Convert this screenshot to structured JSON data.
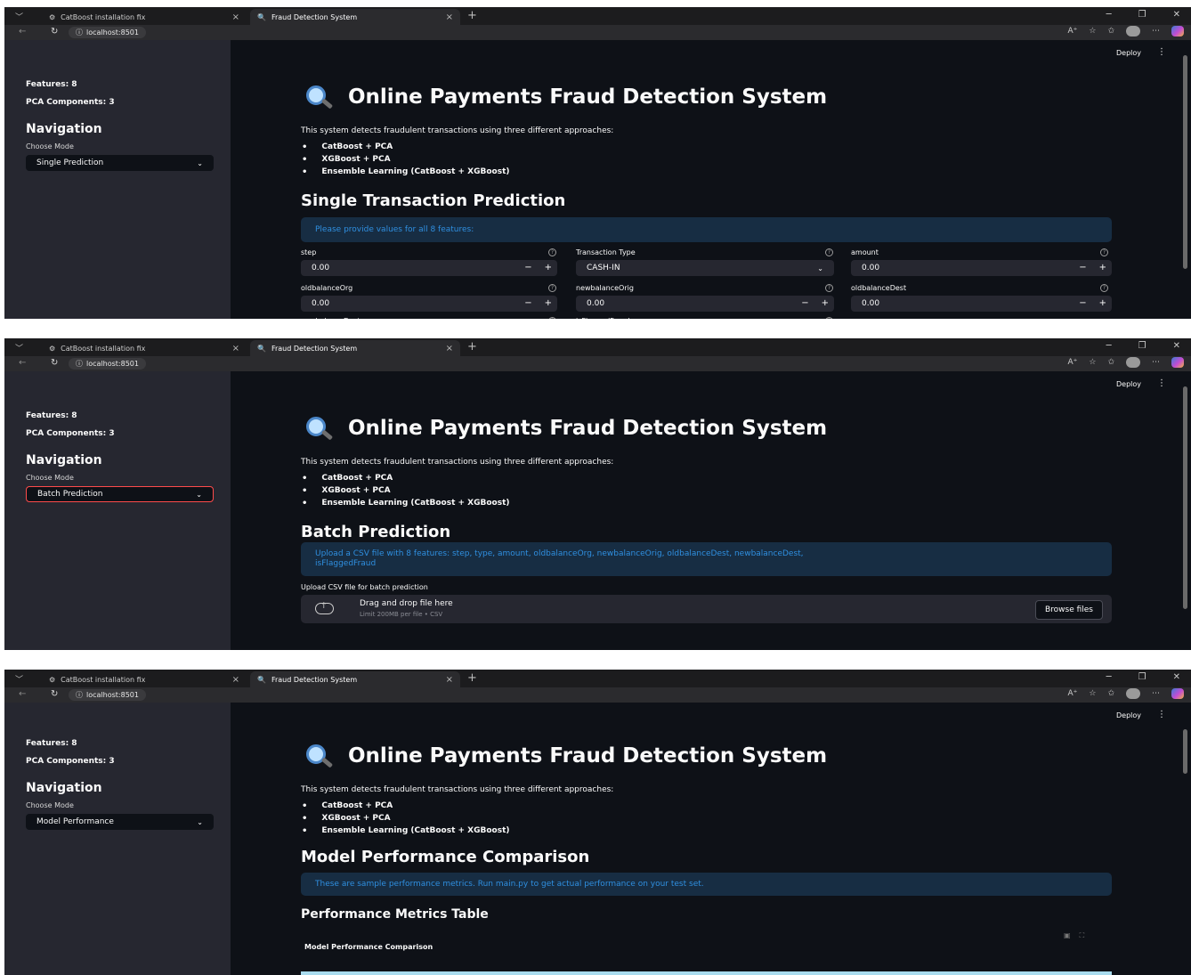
{
  "browser": {
    "tab_inactive": "CatBoost installation fix",
    "tab_active": "Fraud Detection System",
    "url": "localhost:8501",
    "addr_tools": [
      "A⁺",
      "☆",
      "✩",
      "⋯"
    ]
  },
  "header": {
    "deploy": "Deploy"
  },
  "sidebar": {
    "features": "Features: 8",
    "pca": "PCA Components: 3",
    "nav_title": "Navigation",
    "mode_label": "Choose Mode"
  },
  "page": {
    "title": "Online Payments Fraud Detection System",
    "intro": "This system detects fraudulent transactions using three different approaches:",
    "approaches": [
      "CatBoost + PCA",
      "XGBoost + PCA",
      "Ensemble Learning (CatBoost + XGBoost)"
    ]
  },
  "screens": [
    {
      "mode": "Single Prediction",
      "heading": "Single Transaction Prediction",
      "info": "Please provide values for all 8 features:",
      "fields": [
        {
          "label": "step",
          "value": "0.00"
        },
        {
          "label": "Transaction Type",
          "value": "CASH-IN"
        },
        {
          "label": "amount",
          "value": "0.00"
        },
        {
          "label": "oldbalanceOrg",
          "value": "0.00"
        },
        {
          "label": "newbalanceOrig",
          "value": "0.00"
        },
        {
          "label": "oldbalanceDest",
          "value": "0.00"
        },
        {
          "label": "newbalanceDest",
          "value": ""
        },
        {
          "label": "isFlaggedFraud",
          "value": ""
        }
      ]
    },
    {
      "mode": "Batch Prediction",
      "heading": "Batch Prediction",
      "info_line1": "Upload a CSV file with 8 features: step, type, amount, oldbalanceOrg, newbalanceOrig, oldbalanceDest, newbalanceDest,",
      "info_line2": "isFlaggedFraud",
      "upload_label": "Upload CSV file for batch prediction",
      "drop_title": "Drag and drop file here",
      "drop_sub": "Limit 200MB per file • CSV",
      "browse": "Browse files"
    },
    {
      "mode": "Model Performance",
      "heading": "Model Performance Comparison",
      "info": "These are sample performance metrics. Run main.py to get actual performance on your test set.",
      "subheading": "Performance Metrics Table",
      "plot_title": "Model Performance Comparison"
    }
  ]
}
